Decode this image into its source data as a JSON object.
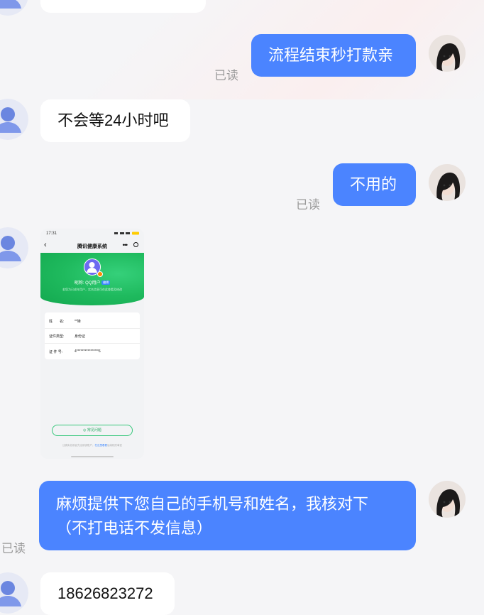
{
  "messages": [
    {
      "text": "流程结束秒打款亲",
      "read": "已读"
    },
    {
      "text": "不会等24小时吧"
    },
    {
      "text": "不用的",
      "read": "已读"
    },
    {
      "text": "麻烦提供下您自己的手机号和姓名，我核对下",
      "text2": "（不打电话不发信息）",
      "read": "已读"
    },
    {
      "text": "18626823272"
    }
  ],
  "screenshot": {
    "time": "17:31",
    "title": "腾讯健康系统",
    "back": "‹",
    "more": "•••",
    "nickname": "昵称: QQ用户",
    "tag": "编辑",
    "hint": "若您为已成年用户，实名信息可在此查看及修改",
    "rows": [
      {
        "label": "姓　　名:",
        "value": "**锋"
      },
      {
        "label": "证件类型:",
        "value": "身份证"
      },
      {
        "label": "证 件 号:",
        "value": "4****************6"
      }
    ],
    "faq": "常见问题",
    "footer": "注销实名前会先注销该账户，",
    "footer_link": "在这里看看",
    "footer_end": "后续相关事宜"
  },
  "colors": {
    "outgoing": "#4b84ff",
    "incoming": "#ffffff",
    "read": "#9a9a9a"
  },
  "icons": {
    "other_avatar": "default-person-avatar",
    "self_avatar": "photo-avatar"
  }
}
